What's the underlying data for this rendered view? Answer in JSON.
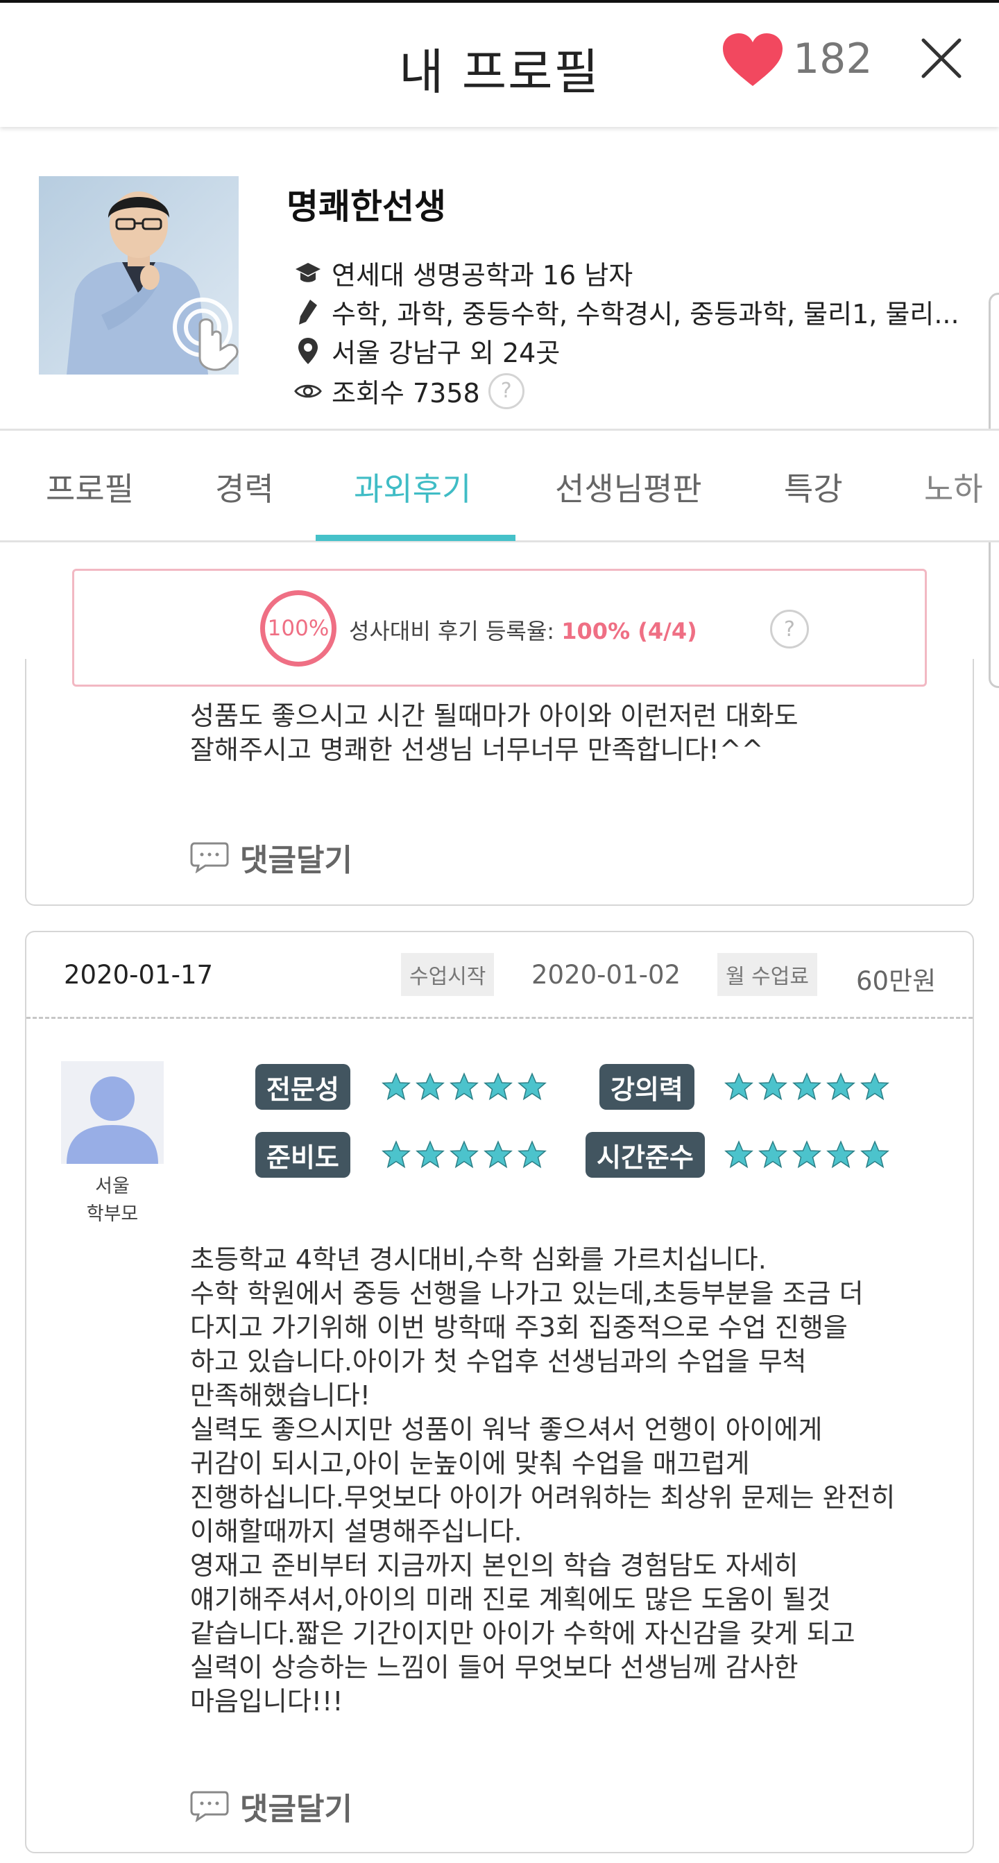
{
  "header": {
    "title": "내 프로필",
    "like_count": "182",
    "heart_color": "#f2485f"
  },
  "profile": {
    "name": "명쾌한선생",
    "school": "연세대 생명공학과 16 남자",
    "subjects": "수학, 과학, 중등수학, 수학경시, 중등과학, 물리1, 물리...",
    "location": "서울 강남구 외 24곳",
    "views": "조회수 7358",
    "help": "?"
  },
  "tabs": [
    {
      "label": "프로필",
      "active": false
    },
    {
      "label": "경력",
      "active": false
    },
    {
      "label": "과외후기",
      "active": true
    },
    {
      "label": "선생님평판",
      "active": false
    },
    {
      "label": "특강",
      "active": false
    },
    {
      "label": "노하",
      "active": false
    }
  ],
  "review_rate": {
    "ring_label": "100%",
    "label": "성사대비 후기 등록율: ",
    "value": "100% (4/4)",
    "help": "?",
    "accent": "#ef6f84"
  },
  "reviews": [
    {
      "text": "성품도 좋으시고 시간 될때마가 아이와 이런저런 대화도\n잘해주시고 명쾌한 선생님 너무너무 만족합니다!^^",
      "comment_label": "댓글달기"
    },
    {
      "date": "2020-01-17",
      "start_tag": "수업시작",
      "start_date": "2020-01-02",
      "fee_tag": "월 수업료",
      "fee": "60만원",
      "reviewer_region": "서울",
      "reviewer_type": "학부모",
      "ratings": [
        {
          "label": "전문성",
          "stars": 5
        },
        {
          "label": "강의력",
          "stars": 5
        },
        {
          "label": "준비도",
          "stars": 5
        },
        {
          "label": "시간준수",
          "stars": 5
        }
      ],
      "text": "초등학교 4학년 경시대비,수학 심화를 가르치십니다.\n수학 학원에서 중등 선행을 나가고 있는데,초등부분을 조금 더\n다지고 가기위해 이번 방학때 주3회 집중적으로 수업 진행을\n하고 있습니다.아이가 첫 수업후 선생님과의 수업을 무척\n만족해했습니다!\n실력도 좋으시지만 성품이 워낙 좋으셔서 언행이 아이에게\n귀감이 되시고,아이 눈높이에 맞춰 수업을 매끄럽게\n진행하십니다.무엇보다 아이가 어려워하는 최상위 문제는 완전히\n이해할때까지 설명해주십니다.\n영재고 준비부터 지금까지 본인의 학습 경험담도 자세히\n얘기해주셔서,아이의 미래 진로 계획에도 많은 도움이 될것\n같습니다.짧은 기간이지만 아이가 수학에 자신감을 갖게 되고\n실력이 상승하는 느낌이 들어 무엇보다 선생님께 감사한\n마음입니다!!!",
      "comment_label": "댓글달기"
    }
  ],
  "star_color": "#4cc3cc"
}
